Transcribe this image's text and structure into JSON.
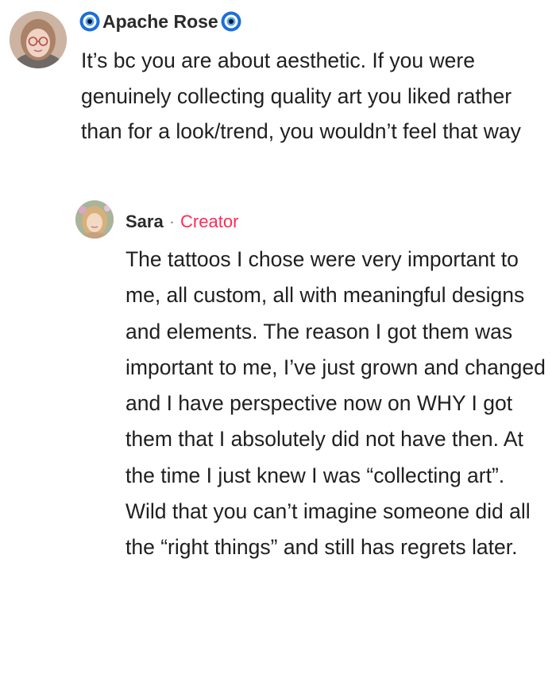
{
  "comment": {
    "author": "Apache Rose",
    "author_prefix_icon": "nazar-eye-icon",
    "author_suffix_icon": "nazar-eye-icon",
    "text": "It’s bc you are about aesthetic. If you were genuinely collecting quality art you liked rather than for a look/trend, you wouldn’t feel that way"
  },
  "reply": {
    "author": "Sara",
    "separator": "·",
    "badge": "Creator",
    "text": "The tattoos I chose were very important to me, all custom, all with meaningful designs and elements. The reason I got them was important to me, I’ve just grown and changed and I have perspective now on WHY I got them that I absolutely did not have then. At the time I just knew I was “collecting art”. Wild that you can’t imagine someone did all the “right things” and still has regrets later."
  },
  "colors": {
    "creator_badge": "#fe2c55",
    "nazar_blue": "#1c6fd6",
    "text": "#1f1f1f"
  }
}
